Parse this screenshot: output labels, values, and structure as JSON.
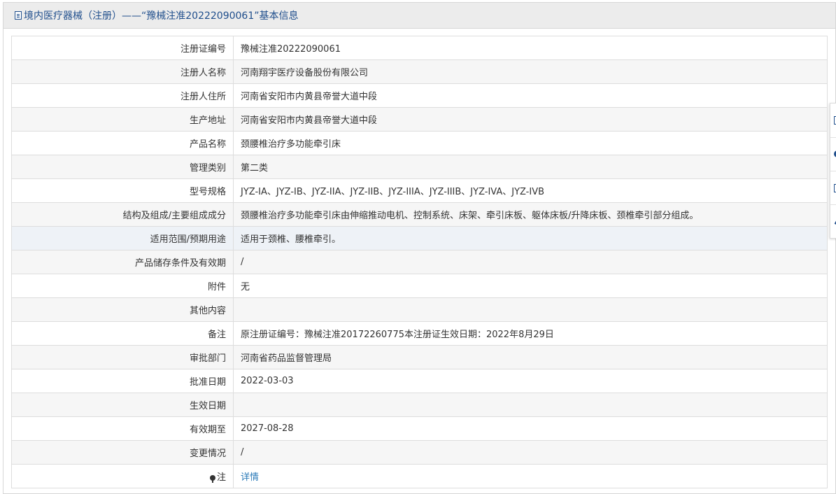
{
  "header": {
    "title": "境内医疗器械（注册）——“豫械注准20222090061”基本信息",
    "icon": "document-icon"
  },
  "rows": [
    {
      "label": "注册证编号",
      "value": "豫械注准20222090061"
    },
    {
      "label": "注册人名称",
      "value": "河南翔宇医疗设备股份有限公司"
    },
    {
      "label": "注册人住所",
      "value": "河南省安阳市内黄县帝誉大道中段"
    },
    {
      "label": "生产地址",
      "value": "河南省安阳市内黄县帝誉大道中段"
    },
    {
      "label": "产品名称",
      "value": "颈腰椎治疗多功能牵引床"
    },
    {
      "label": "管理类别",
      "value": "第二类"
    },
    {
      "label": "型号规格",
      "value": "JYZ-IA、JYZ-IB、JYZ-IIA、JYZ-IIB、JYZ-IIIA、JYZ-IIIB、JYZ-IVA、JYZ-IVB"
    },
    {
      "label": "结构及组成/主要组成成分",
      "value": "颈腰椎治疗多功能牵引床由伸缩推动电机、控制系统、床架、牵引床板、躯体床板/升降床板、颈椎牵引部分组成。"
    },
    {
      "label": "适用范围/预期用途",
      "value": "适用于颈椎、腰椎牵引。"
    },
    {
      "label": "产品储存条件及有效期",
      "value": "/"
    },
    {
      "label": "附件",
      "value": "无"
    },
    {
      "label": "其他内容",
      "value": ""
    },
    {
      "label": "备注",
      "value": "原注册证编号：豫械注准20172260775本注册证生效日期：2022年8月29日"
    },
    {
      "label": "审批部门",
      "value": "河南省药品监督管理局"
    },
    {
      "label": "批准日期",
      "value": "2022-03-03"
    },
    {
      "label": "生效日期",
      "value": ""
    },
    {
      "label": "有效期至",
      "value": "2027-08-28"
    },
    {
      "label": "变更情况",
      "value": "/"
    }
  ],
  "note_row": {
    "label": "注",
    "icon": "lightbulb-icon",
    "link_text": "详情"
  },
  "side_toolbar": [
    "document-icon",
    "circle-icon",
    "share-icon",
    "pen-icon"
  ],
  "colors": {
    "title": "#1f4e8c",
    "link": "#2a7ab8",
    "header_bg": "#ececec",
    "border": "#dddddd"
  }
}
